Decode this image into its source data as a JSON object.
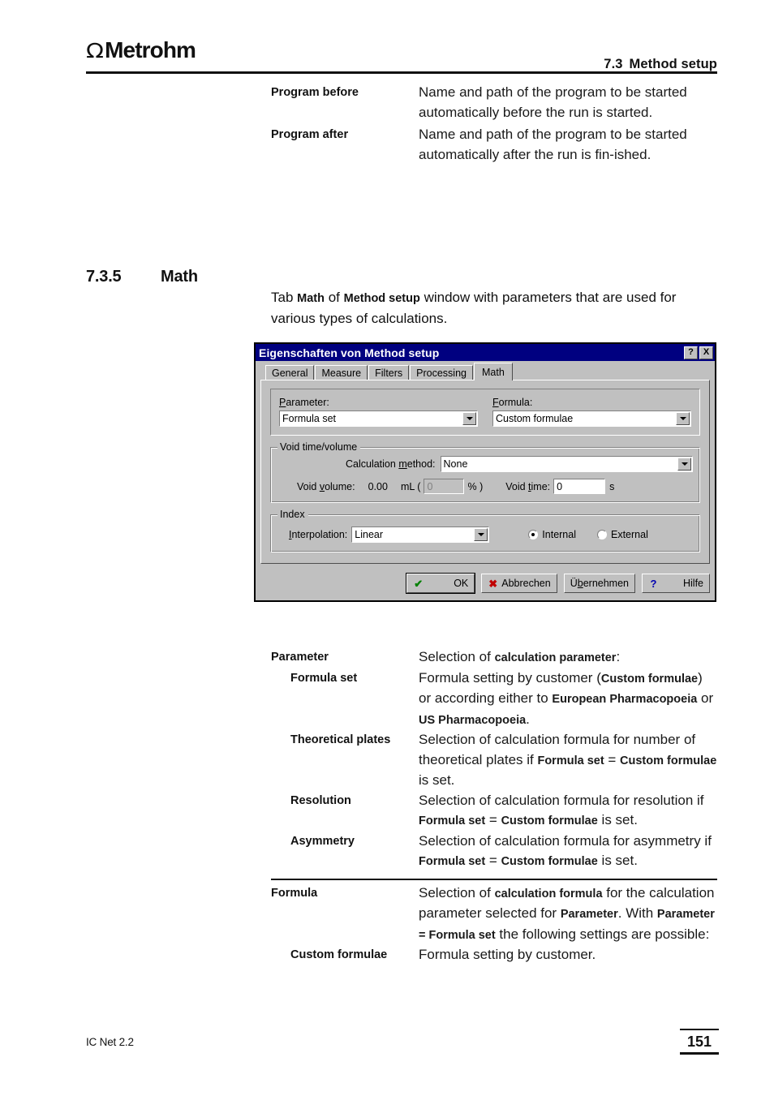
{
  "header": {
    "logo_symbol": "Ω",
    "logo_text": "Metrohm",
    "section_number": "7.3",
    "section_title": "Method setup"
  },
  "top_block": [
    {
      "term": "Program before",
      "desc": "Name and path of the program to be started automatically before the run is started."
    },
    {
      "term": "Program after",
      "desc": "Name and path of the program to be started automatically after the run is fin-ished."
    }
  ],
  "section": {
    "number": "7.3.5",
    "title": "Math",
    "intro_a": "Tab ",
    "intro_b1": "Math",
    "intro_c": " of ",
    "intro_b2": "Method setup",
    "intro_d": " window with parameters that are used for various types of calculations."
  },
  "dialog": {
    "title": "Eigenschaften von Method setup",
    "help_button": "?",
    "close_button": "X",
    "tabs": [
      {
        "label": "General",
        "active": false
      },
      {
        "label": "Measure",
        "active": false
      },
      {
        "label": "Filters",
        "active": false
      },
      {
        "label": "Processing",
        "active": false
      },
      {
        "label": "Math",
        "active": true
      }
    ],
    "parameter": {
      "label_pre": "",
      "label_mnemonic": "P",
      "label_post": "arameter:",
      "value": "Formula set"
    },
    "formula": {
      "label_mnemonic": "F",
      "label_post": "ormula:",
      "value": "Custom formulae"
    },
    "void_group": {
      "legend": "Void time/volume",
      "calc_method": {
        "label_pre": "Calculation ",
        "label_mnemonic": "m",
        "label_post": "ethod:",
        "value": "None"
      },
      "void_volume": {
        "label_pre": "Void ",
        "label_mnemonic": "v",
        "label_post": "olume:",
        "value": "0.00",
        "unit": "mL (",
        "percent_value": "0",
        "percent_unit": "% )"
      },
      "void_time": {
        "label_pre": "Void ",
        "label_mnemonic": "t",
        "label_post": "ime:",
        "value": "0",
        "unit": "s"
      }
    },
    "index_group": {
      "legend": "Index",
      "interpolation": {
        "label_mnemonic": "I",
        "label_post": "nterpolation:",
        "value": "Linear"
      },
      "radio_internal": "Internal",
      "radio_external": "External",
      "selected": "Internal"
    },
    "buttons": {
      "ok": "OK",
      "cancel": "Abbrechen",
      "apply_pre": "Ü",
      "apply_mnemonic": "b",
      "apply_post": "ernehmen",
      "help": "Hilfe",
      "icon_ok": "✔",
      "icon_cancel": "✖",
      "icon_help": "?"
    }
  },
  "lower_table": {
    "rows": [
      {
        "term": "Parameter",
        "indent": false,
        "parts": [
          {
            "t": "Selection of ",
            "b": false
          },
          {
            "t": "calculation parameter",
            "b": true
          },
          {
            "t": ":",
            "b": false
          }
        ]
      },
      {
        "term": "Formula set",
        "indent": true,
        "parts": [
          {
            "t": "Formula setting by customer (",
            "b": false
          },
          {
            "t": "Custom formulae",
            "b": true
          },
          {
            "t": ") or according either to ",
            "b": false
          },
          {
            "t": "European Pharmacopoeia",
            "b": true
          },
          {
            "t": " or ",
            "b": false
          },
          {
            "t": "US Pharmacopoeia",
            "b": true
          },
          {
            "t": ".",
            "b": false
          }
        ]
      },
      {
        "term": "Theoretical plates",
        "indent": true,
        "parts": [
          {
            "t": "Selection of calculation formula for number of theoretical plates if ",
            "b": false
          },
          {
            "t": "Formula set",
            "b": true
          },
          {
            "t": " = ",
            "b": false
          },
          {
            "t": "Custom formulae",
            "b": true
          },
          {
            "t": " is set.",
            "b": false
          }
        ]
      },
      {
        "term": "Resolution",
        "indent": true,
        "parts": [
          {
            "t": "Selection of calculation formula for resolution if ",
            "b": false
          },
          {
            "t": "Formula set",
            "b": true
          },
          {
            "t": " = ",
            "b": false
          },
          {
            "t": "Custom formulae",
            "b": true
          },
          {
            "t": " is set.",
            "b": false
          }
        ]
      },
      {
        "term": "Asymmetry",
        "indent": true,
        "parts": [
          {
            "t": "Selection of calculation formula for asymmetry if ",
            "b": false
          },
          {
            "t": "Formula set",
            "b": true
          },
          {
            "t": " = ",
            "b": false
          },
          {
            "t": "Custom formulae",
            "b": true
          },
          {
            "t": " is set.",
            "b": false
          }
        ]
      }
    ],
    "rows_after_rule": [
      {
        "term": "Formula",
        "indent": false,
        "parts": [
          {
            "t": "Selection of ",
            "b": false
          },
          {
            "t": "calculation formula",
            "b": true
          },
          {
            "t": " for the calculation parameter selected for ",
            "b": false
          },
          {
            "t": "Parameter",
            "b": true
          },
          {
            "t": ". With ",
            "b": false
          },
          {
            "t": "Parameter = Formula set",
            "b": true
          },
          {
            "t": " the following settings are possible:",
            "b": false
          }
        ]
      },
      {
        "term": "Custom formulae",
        "indent": true,
        "parts": [
          {
            "t": "Formula setting by customer.",
            "b": false
          }
        ]
      }
    ]
  },
  "footer": {
    "product": "IC Net 2.2",
    "page_number": "151"
  }
}
